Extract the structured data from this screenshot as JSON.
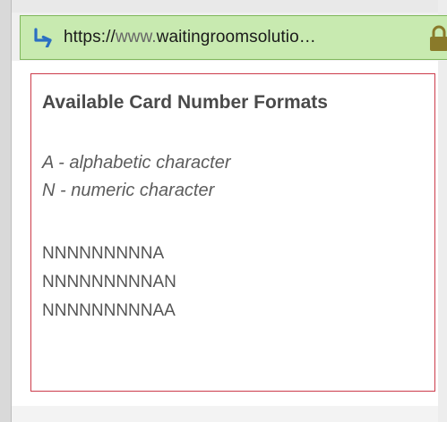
{
  "browser": {
    "url_scheme": "https://",
    "url_host_prefix": "www.",
    "url_host": "waitingroomsolutio…"
  },
  "panel": {
    "heading": "Available Card Number Formats",
    "legend": [
      "A - alphabetic character",
      "N - numeric character"
    ],
    "formats": [
      "NNNNNNNNNA",
      "NNNNNNNNNAN",
      "NNNNNNNNNAA"
    ]
  },
  "colors": {
    "address_bar_bg": "#c8eab0",
    "panel_border": "#cc3b4a",
    "nav_icon": "#2b6fc2",
    "lock_icon": "#8a7a2a"
  }
}
